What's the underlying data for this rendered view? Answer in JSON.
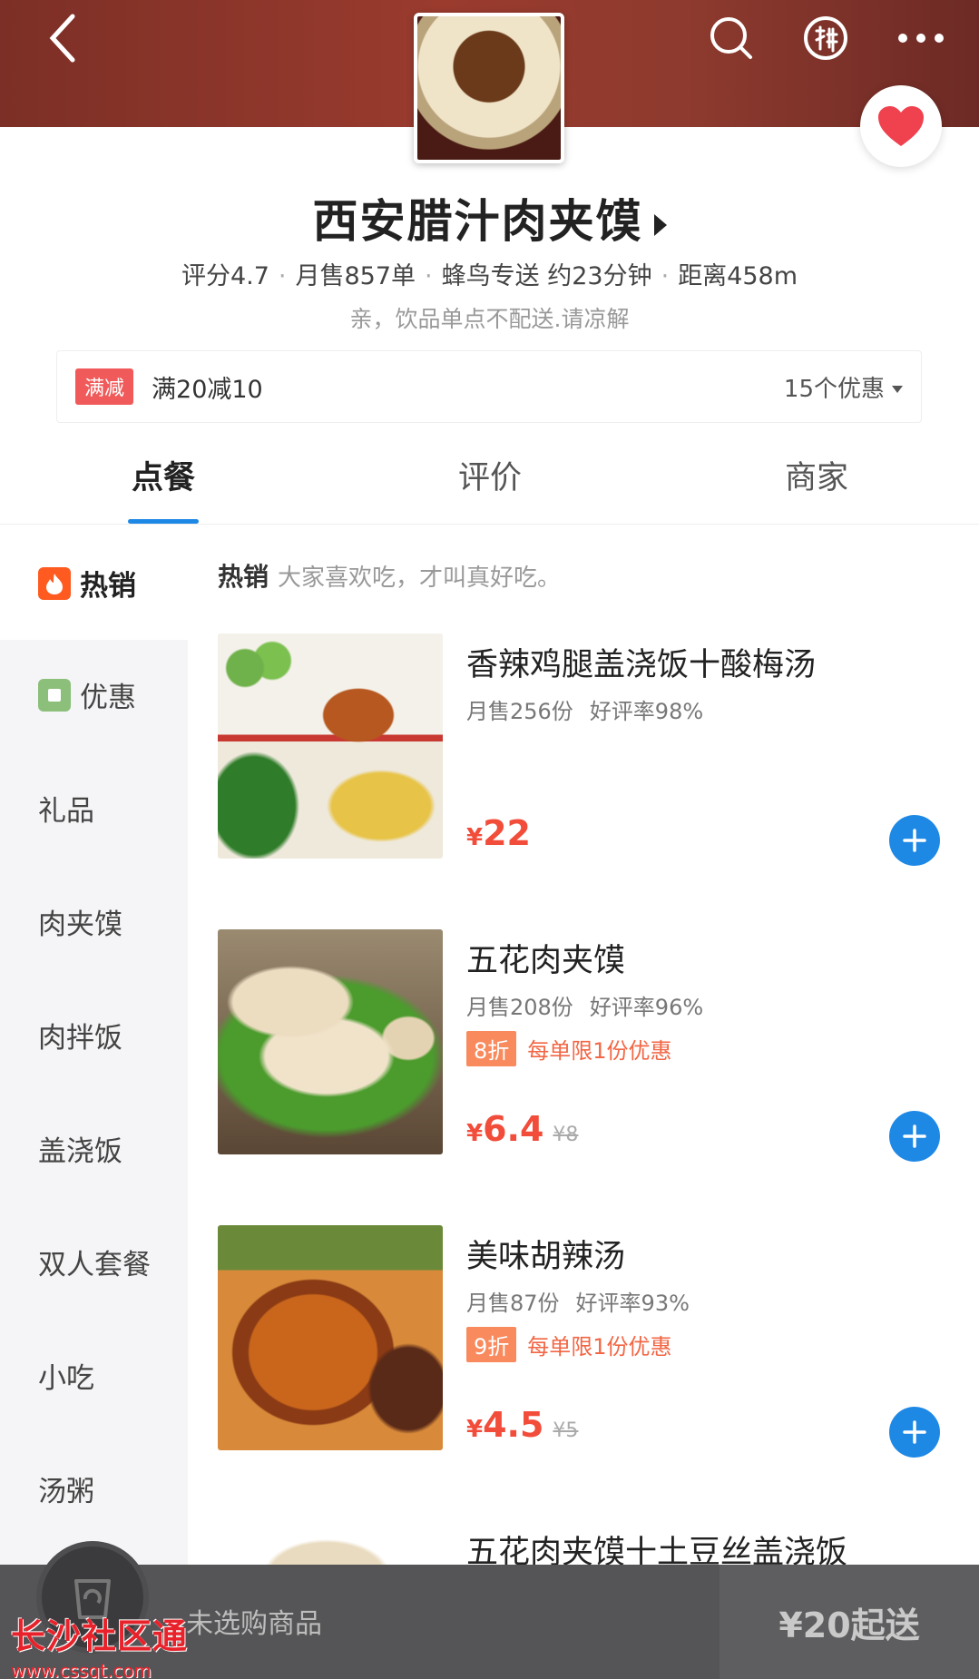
{
  "shop": {
    "name": "西安腊汁肉夹馍",
    "rating": "评分4.7",
    "monthly_sales": "月售857单",
    "delivery": "蜂鸟专送 约23分钟",
    "distance": "距离458m",
    "notice": "亲，饮品单点不配送.请凉解"
  },
  "promo": {
    "tag": "满减",
    "text": "满20减10",
    "count": "15个优惠"
  },
  "tabs": [
    "点餐",
    "评价",
    "商家"
  ],
  "sidebar": {
    "items": [
      "热销",
      "优惠",
      "礼品",
      "肉夹馍",
      "肉拌饭",
      "盖浇饭",
      "双人套餐",
      "小吃",
      "汤粥"
    ]
  },
  "section": {
    "title": "热销",
    "slogan": "大家喜欢吃，才叫真好吃。"
  },
  "items": [
    {
      "name": "香辣鸡腿盖浇饭十酸梅汤",
      "sales": "月售256份",
      "rating": "好评率98%",
      "discount_badge": "",
      "discount_text": "",
      "currency": "¥",
      "price": "22",
      "old_price": ""
    },
    {
      "name": "五花肉夹馍",
      "sales": "月售208份",
      "rating": "好评率96%",
      "discount_badge": "8折",
      "discount_text": "每单限1份优惠",
      "currency": "¥",
      "price": "6.4",
      "old_price": "¥8"
    },
    {
      "name": "美味胡辣汤",
      "sales": "月售87份",
      "rating": "好评率93%",
      "discount_badge": "9折",
      "discount_text": "每单限1份优惠",
      "currency": "¥",
      "price": "4.5",
      "old_price": "¥5"
    },
    {
      "name": "五花肉夹馍十土豆丝盖浇饭"
    }
  ],
  "cart": {
    "empty_text": "未选购商品",
    "min_order": "¥20起送"
  },
  "watermark": {
    "title": "长沙社区通",
    "url": "www.cssqt.com"
  },
  "colors": {
    "accent": "#1e88e5",
    "price": "#f24c3a",
    "promo_tag": "#f05a5a",
    "discount": "#f88a5e"
  }
}
